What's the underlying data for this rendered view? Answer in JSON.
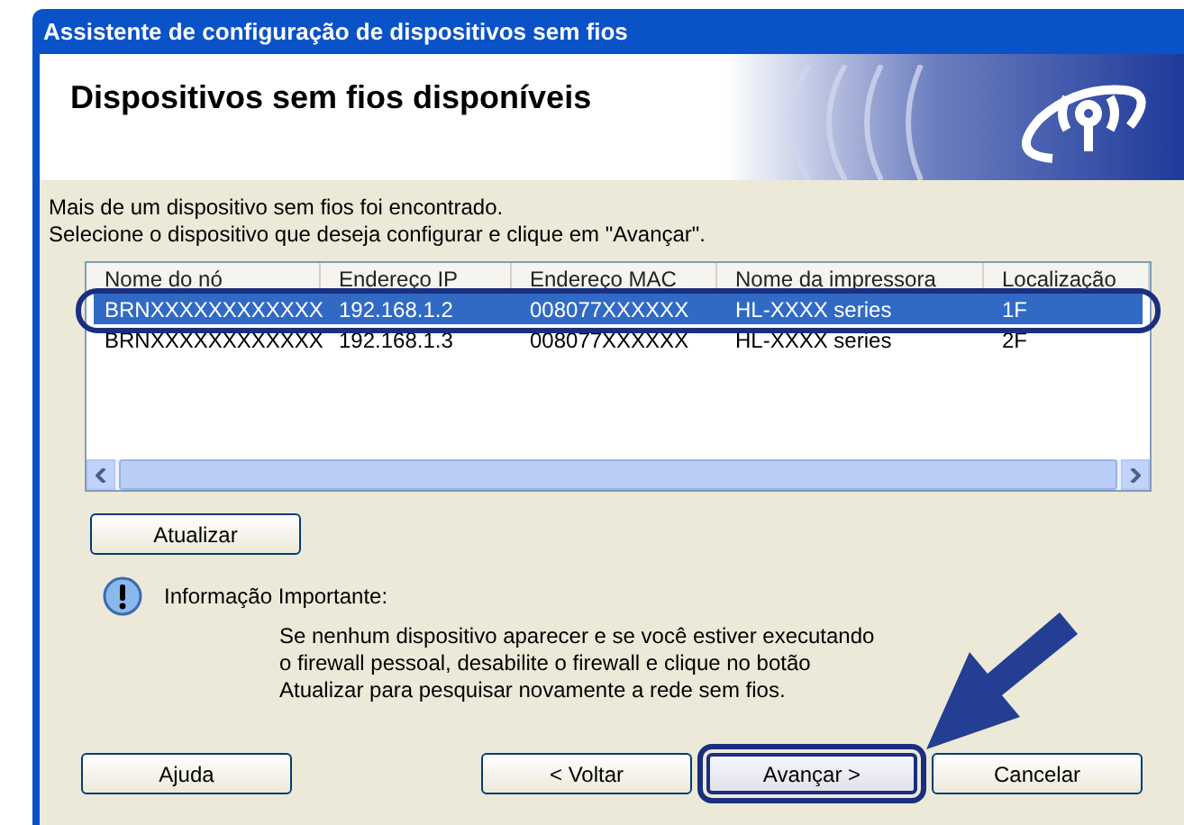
{
  "window": {
    "title": "Assistente de configuração de dispositivos sem fios"
  },
  "heading": "Dispositivos sem fios disponíveis",
  "intro": [
    "Mais de um dispositivo sem fios foi encontrado.",
    "Selecione o dispositivo que deseja configurar e clique em \"Avançar\"."
  ],
  "table": {
    "columns": [
      "Nome do nó",
      "Endereço IP",
      "Endereço MAC",
      "Nome da impressora",
      "Localização"
    ],
    "rows": [
      {
        "cells": [
          "BRNXXXXXXXXXXXX",
          "192.168.1.2",
          "008077XXXXXX",
          "HL-XXXX series",
          "1F"
        ],
        "selected": true
      },
      {
        "cells": [
          "BRNXXXXXXXXXXXX",
          "192.168.1.3",
          "008077XXXXXX",
          "HL-XXXX series",
          "2F"
        ],
        "selected": false
      }
    ]
  },
  "refresh_button": "Atualizar",
  "info": {
    "title": "Informação Importante:",
    "text": "Se nenhum dispositivo aparecer e se você estiver executando o firewall pessoal, desabilite o firewall e clique no botão Atualizar para pesquisar novamente a rede sem fios."
  },
  "buttons": [
    {
      "label": "Ajuda",
      "highlighted": false
    },
    {
      "label": "< Voltar",
      "highlighted": false
    },
    {
      "label": "Avançar >",
      "highlighted": true
    },
    {
      "label": "Cancelar",
      "highlighted": false
    }
  ]
}
